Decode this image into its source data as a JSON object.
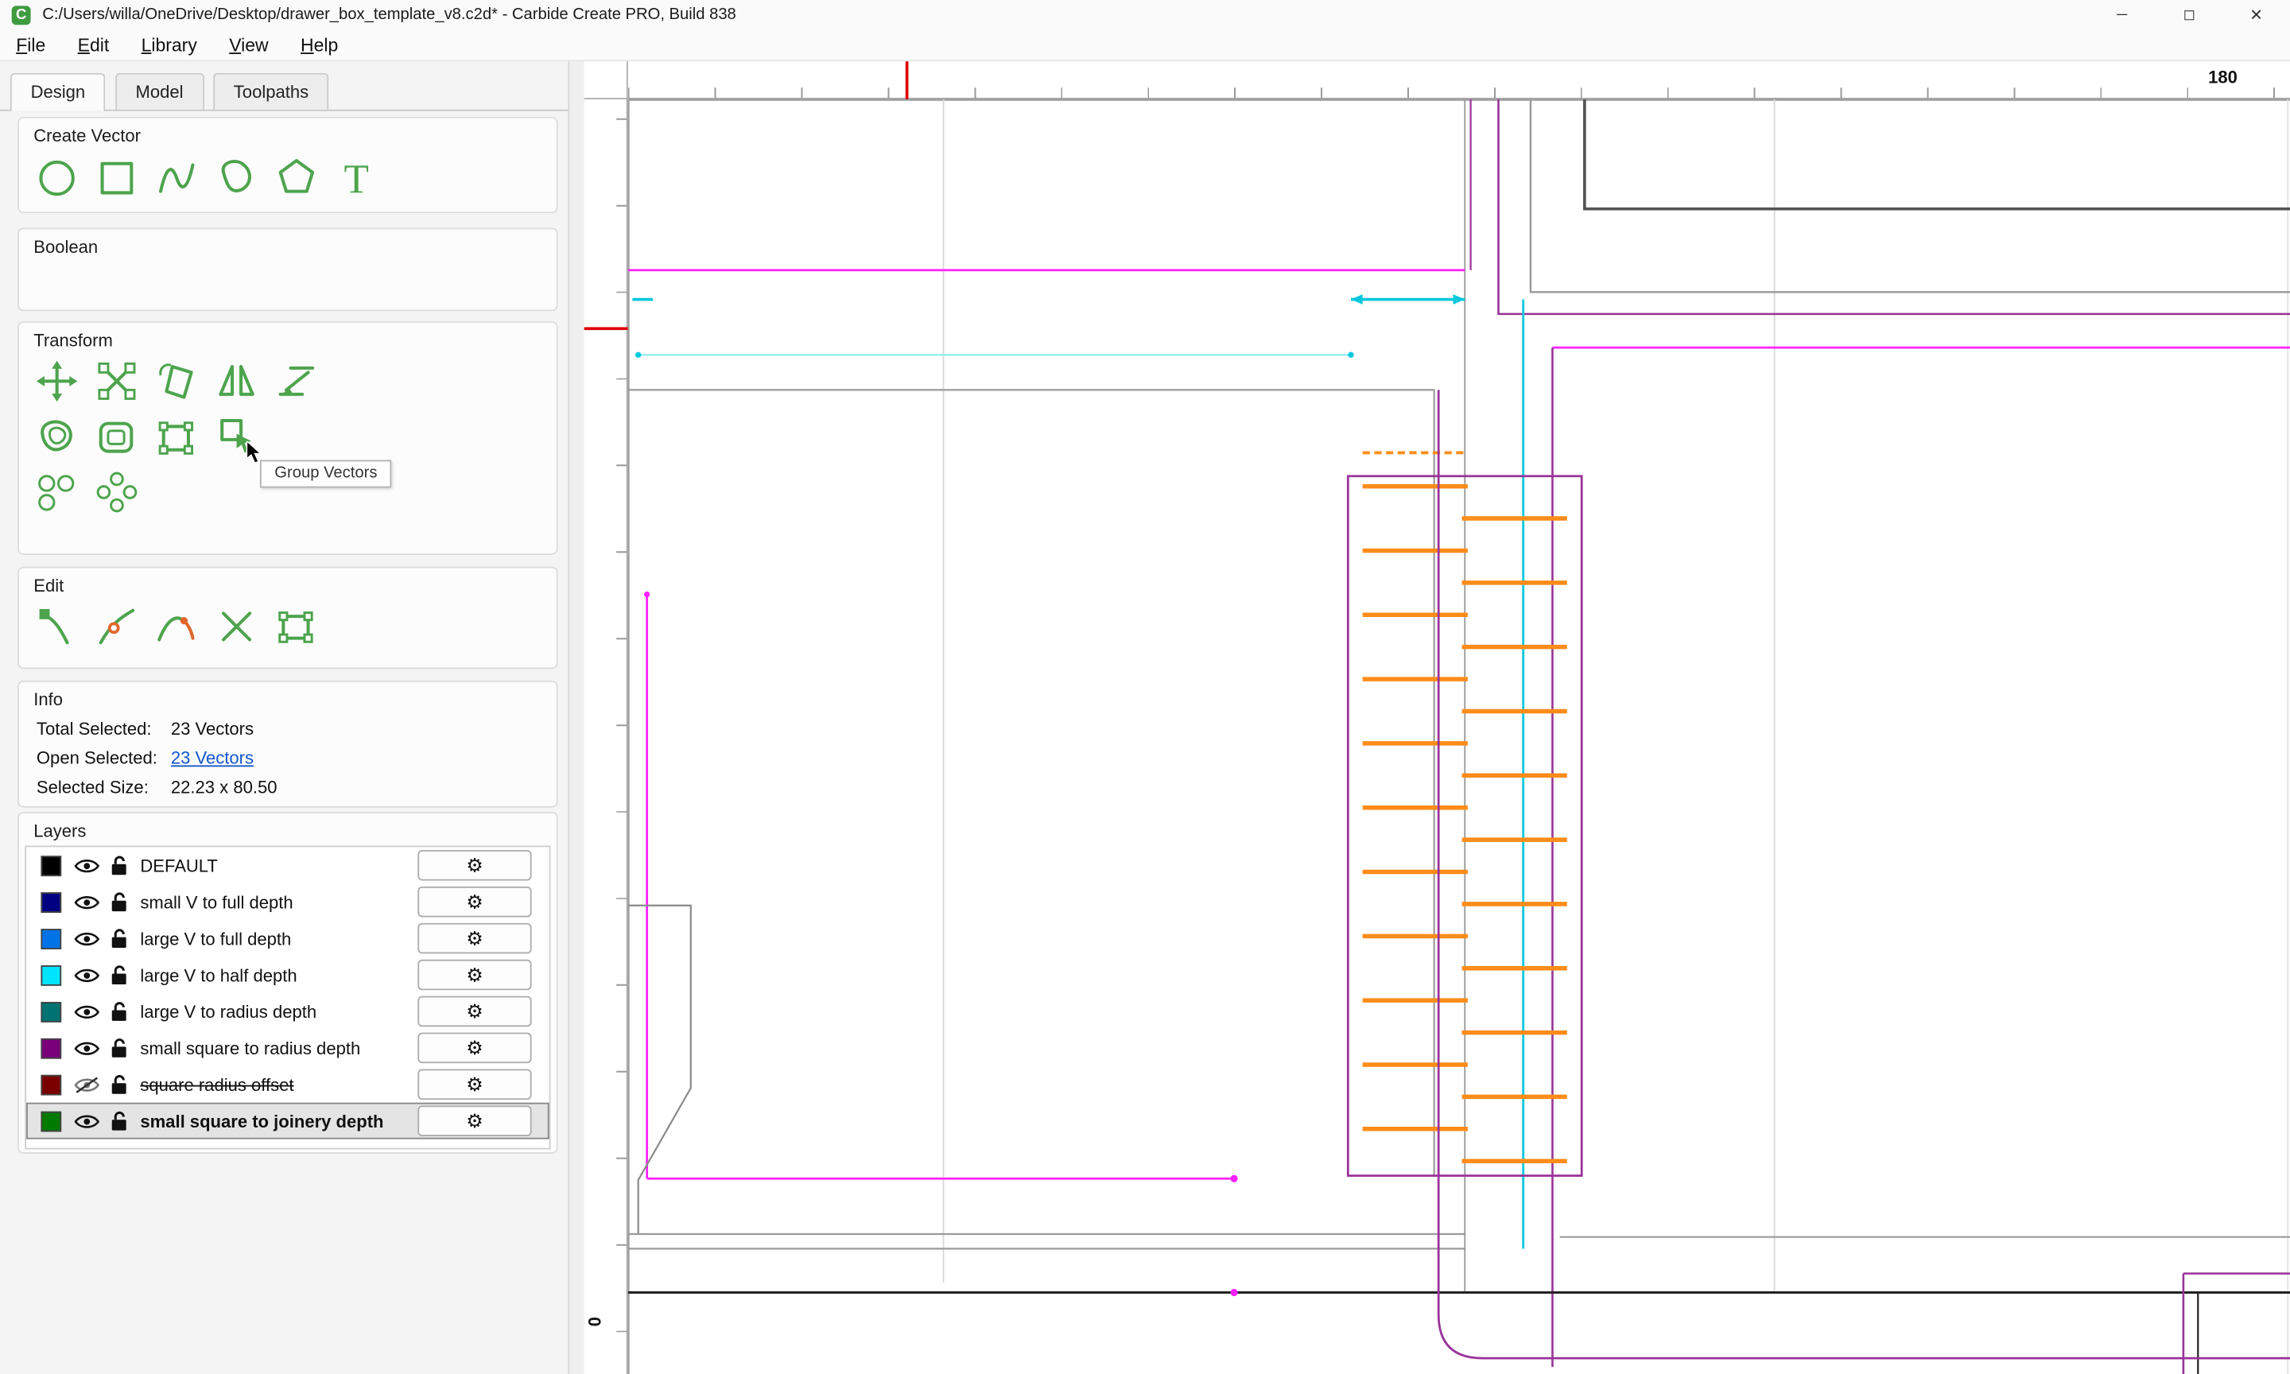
{
  "window": {
    "app_icon_letter": "C",
    "title": "C:/Users/willa/OneDrive/Desktop/drawer_box_template_v8.c2d* - Carbide Create PRO, Build 838",
    "minimize": "─",
    "maximize": "◻",
    "close": "✕"
  },
  "menu": {
    "file": "File",
    "edit": "Edit",
    "library": "Library",
    "view": "View",
    "help": "Help"
  },
  "tabs": {
    "design": "Design",
    "model": "Model",
    "toolpaths": "Toolpaths"
  },
  "panels": {
    "create_vector_title": "Create Vector",
    "boolean_title": "Boolean",
    "transform_title": "Transform",
    "edit_title": "Edit",
    "info_title": "Info",
    "layers_title": "Layers"
  },
  "transform": {
    "tooltip": "Group Vectors"
  },
  "info": {
    "total_label": "Total Selected:",
    "total_value": "23 Vectors",
    "open_label": "Open Selected:",
    "open_value": "23 Vectors",
    "size_label": "Selected Size:",
    "size_value": "22.23 x 80.50"
  },
  "layers": {
    "items": [
      {
        "name": "DEFAULT",
        "color": "#000000",
        "visible": true
      },
      {
        "name": "small V to full depth",
        "color": "#000080",
        "visible": true
      },
      {
        "name": "large V to full depth",
        "color": "#0073e6",
        "visible": true
      },
      {
        "name": "large V to half depth",
        "color": "#00e5ff",
        "visible": true
      },
      {
        "name": "large V to radius depth",
        "color": "#007272",
        "visible": true
      },
      {
        "name": "small square to radius depth",
        "color": "#7a007a",
        "visible": true
      },
      {
        "name": "square radius offset",
        "color": "#7a0000",
        "visible": false
      },
      {
        "name": "small square to joinery depth",
        "color": "#007a00",
        "visible": true,
        "selected": true
      }
    ]
  },
  "ruler": {
    "top_label": "180",
    "left_label": "0"
  },
  "icons": {
    "gear": "⚙"
  },
  "colors": {
    "tool_icon_green": "#4da44d",
    "selection_magenta": "#ff22ff",
    "layer_purple": "#993399",
    "layer_cyan": "#00c8dc",
    "joinery_orange": "#ff8c1a",
    "ruler_marker_red": "#dd0000"
  }
}
